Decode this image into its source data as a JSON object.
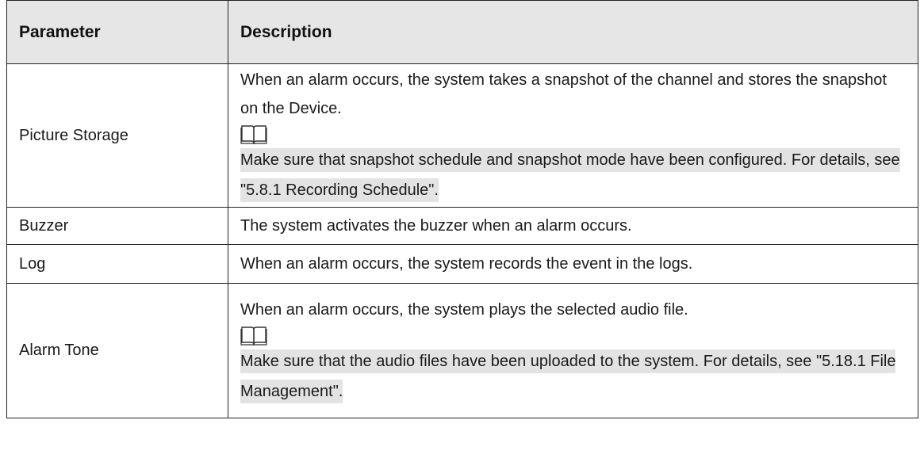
{
  "header": {
    "parameter": "Parameter",
    "description": "Description"
  },
  "rows": [
    {
      "parameter": "Picture Storage",
      "description": "When an alarm occurs, the system takes a snapshot of the channel and stores the snapshot on the Device.",
      "note_icon": "book-icon",
      "note": "Make sure that snapshot schedule and snapshot mode have been configured. For details, see \"5.8.1 Recording Schedule\"."
    },
    {
      "parameter": "Buzzer",
      "description": "The system activates the buzzer when an alarm occurs."
    },
    {
      "parameter": "Log",
      "description": "When an alarm occurs, the system records the event in the logs."
    },
    {
      "parameter": "Alarm Tone",
      "description": "When an alarm occurs, the system plays the selected audio file.",
      "note_icon": "book-icon",
      "note": "Make sure that the audio files have been uploaded to the system. For details, see \"5.18.1 File Management\"."
    }
  ],
  "colors": {
    "header_bg": "#e6e6e6",
    "note_bg": "#e3e3e3",
    "border": "#222222"
  }
}
